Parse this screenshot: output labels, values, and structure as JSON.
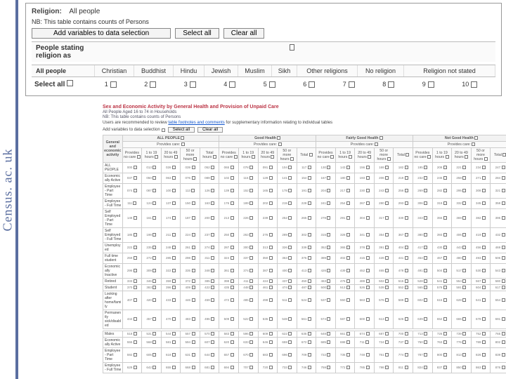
{
  "side_label": "Census. ac. uk",
  "top": {
    "religion_label": "Religion:",
    "religion_value": "All people",
    "nb_text": "NB: This table contains counts of Persons",
    "btn_add": "Add variables to data selection",
    "btn_select_all": "Select all",
    "btn_clear_all": "Clear all",
    "header_people_stating": "People stating religion as",
    "all_people": "All people",
    "columns": [
      "Christian",
      "Buddhist",
      "Hindu",
      "Jewish",
      "Muslim",
      "Sikh",
      "Other religions",
      "No religion",
      "Religion not stated"
    ],
    "select_all": "Select all",
    "numbers": [
      "1",
      "2",
      "3",
      "4",
      "5",
      "6",
      "7",
      "8",
      "9",
      "10"
    ]
  },
  "lower": {
    "title": "Sex and Economic Activity by General Health and Provision of Unpaid Care",
    "sub1": "All People Aged 16 to 74 in Households",
    "sub2": "NB: This table contains counts of Persons",
    "tip_pre": "Users are recommended to review ",
    "tip_link": "table footnotes and comments",
    "tip_post": " for supplementary information relating to individual tables",
    "add_vars_lead": "Add variables to data selection",
    "btn_select_all": "Select all",
    "btn_clear_all": "Clear all",
    "group_headers": [
      "ALL PEOPLE",
      "Good Health",
      "Fairly Good Health",
      "Not Good Health"
    ],
    "provides_care": "Provides care:",
    "sub_cols_first": [
      "Provides no care",
      "1 to 19 hours",
      "20 to 49 hours",
      "50 or more hours",
      "Total hours"
    ],
    "sub_cols": [
      "Provides no care",
      "1 to 19 hours",
      "20 to 49 hours",
      "50 or more hours",
      "Total"
    ],
    "row_group1": "General and economic activity",
    "rows": [
      "ALL PEOPLE",
      "Economically Active",
      "Employee - Part Time",
      "Employee - Full Time",
      "Self Employed - Part Time",
      "Self Employed - Full Time",
      "Unemployed",
      "Full time student",
      "Economically Inactive",
      "Retired",
      "Student",
      "Looking after home/family",
      "Permanently sick/disabled",
      "",
      "Males",
      "Economically Active",
      "Employee - Part Time",
      "Employee - Full Time"
    ]
  }
}
